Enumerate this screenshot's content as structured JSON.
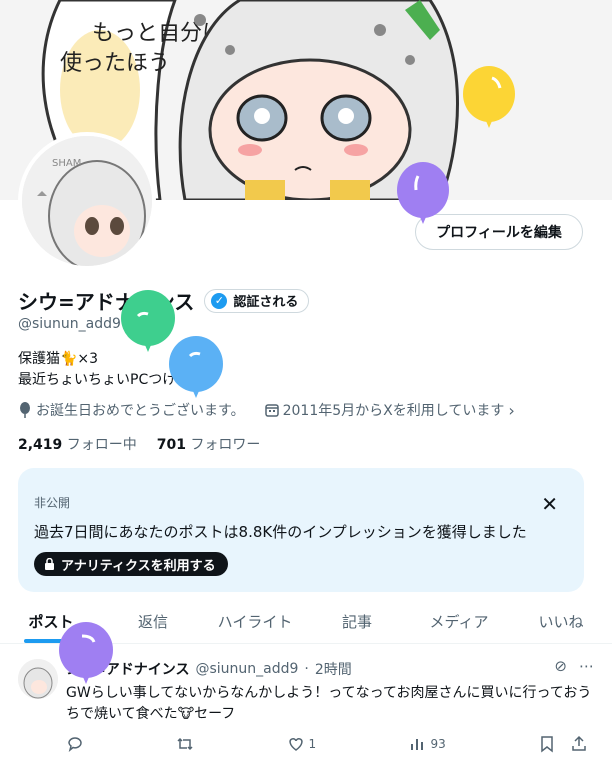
{
  "profile": {
    "display_name": "シウ=アドナインス",
    "verify_label": "認証される",
    "handle": "@siunun_add9",
    "bio_line1": "保護猫🐈×3",
    "bio_line2": "最近ちょいちょいPCつけてます",
    "birthday": "お誕生日おめでとうございます。",
    "joined": "2011年5月からXを利用しています",
    "following_count": "2,419",
    "following_label": "フォロー中",
    "followers_count": "701",
    "followers_label": "フォロワー",
    "edit_button": "プロフィールを編集"
  },
  "banner": {
    "text_line1": "もっと自分に",
    "text_line2": "使ったほう"
  },
  "analytics": {
    "private_label": "非公開",
    "message": "過去7日間にあなたのポストは8.8K件のインプレッションを獲得しました",
    "button_label": "アナリティクスを利用する"
  },
  "tabs": [
    {
      "label": "ポスト",
      "active": true
    },
    {
      "label": "返信"
    },
    {
      "label": "ハイライト"
    },
    {
      "label": "記事"
    },
    {
      "label": "メディア"
    },
    {
      "label": "いいね"
    }
  ],
  "post": {
    "name": "シウ=アドナインス",
    "handle": "@siunun_add9",
    "time": "2時間",
    "text": "GWらしい事してないからなんかしよう！ってなってお肉屋さんに買いに行っておうちで焼いて食べた🐮セーフ",
    "likes": "1",
    "views": "93"
  },
  "colors": {
    "accent": "#1d9bf0",
    "balloon_yellow": "#fcd535",
    "balloon_purple": "#9f7ff2",
    "balloon_green": "#3ecf8e",
    "balloon_blue": "#5bb1f5"
  }
}
